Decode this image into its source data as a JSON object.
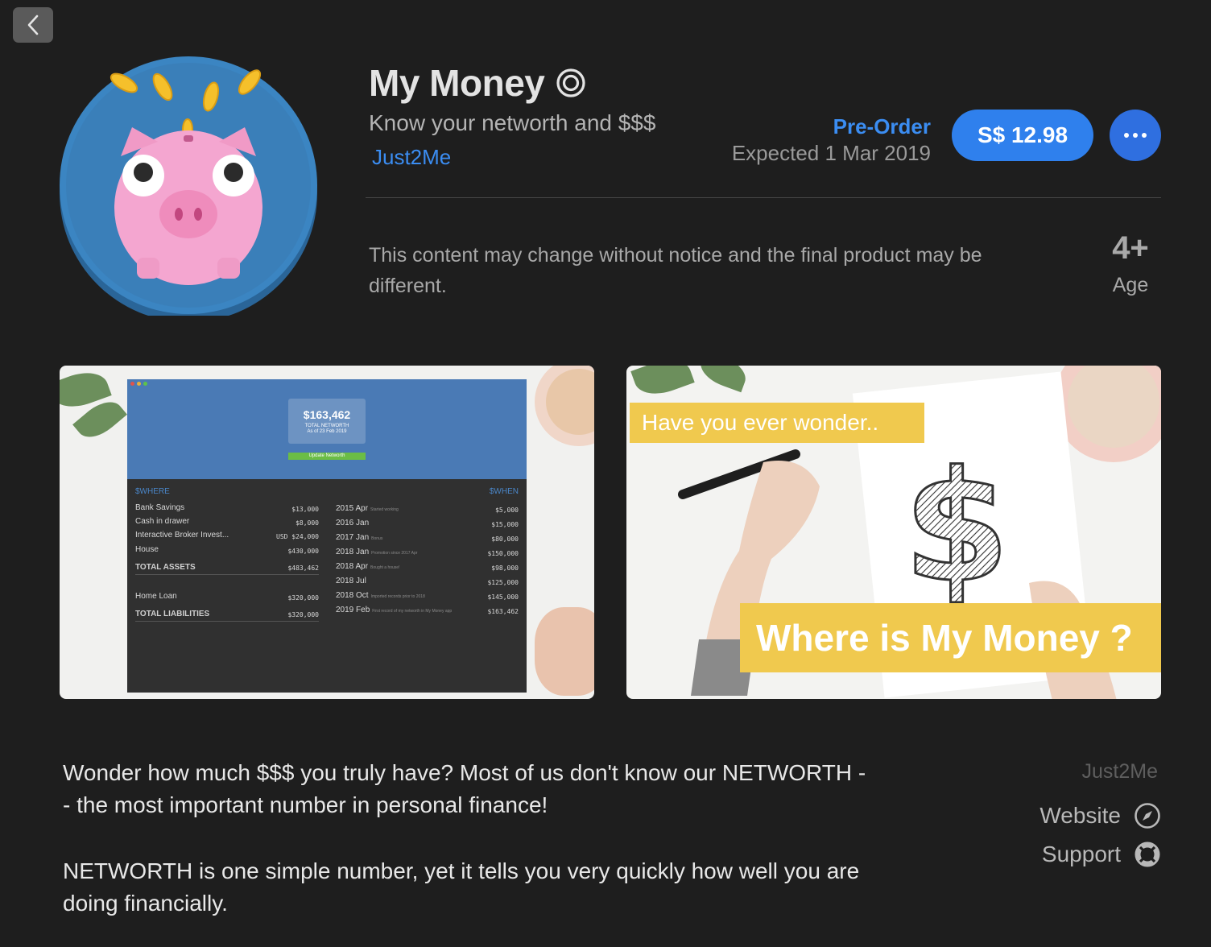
{
  "app": {
    "title": "My Money",
    "subtitle": "Know your networth and $$$",
    "developer": "Just2Me"
  },
  "purchase": {
    "status": "Pre-Order",
    "expected": "Expected 1 Mar 2019",
    "price": "S$ 12.98"
  },
  "notice": "This content may change without notice and the final product may be different.",
  "age": {
    "value": "4+",
    "label": "Age"
  },
  "screenshot1": {
    "networth_amount": "$163,462",
    "networth_label": "TOTAL NETWORTH",
    "networth_date": "As of 23 Feb 2019",
    "update_button": "Update Networth",
    "where_header": "$WHERE",
    "when_header": "$WHEN",
    "assets": [
      {
        "name": "Bank Savings",
        "value": "$13,000"
      },
      {
        "name": "Cash in drawer",
        "value": "$8,000"
      },
      {
        "name": "Interactive Broker Invest...",
        "value": "USD $24,000"
      },
      {
        "name": "House",
        "value": "$430,000"
      }
    ],
    "total_assets_label": "TOTAL ASSETS",
    "total_assets_value": "$483,462",
    "liabilities": [
      {
        "name": "Home Loan",
        "value": "$320,000"
      }
    ],
    "total_liabilities_label": "TOTAL LIABILITIES",
    "total_liabilities_value": "$320,000",
    "history": [
      {
        "date": "2015 Apr",
        "note": "Started working",
        "value": "$5,000"
      },
      {
        "date": "2016 Jan",
        "note": "",
        "value": "$15,000"
      },
      {
        "date": "2017 Jan",
        "note": "Bonus",
        "value": "$80,000"
      },
      {
        "date": "2018 Jan",
        "note": "Promotion since 2017 Apr",
        "value": "$150,000"
      },
      {
        "date": "2018 Apr",
        "note": "Bought a house!",
        "value": "$98,000"
      },
      {
        "date": "2018 Jul",
        "note": "",
        "value": "$125,000"
      },
      {
        "date": "2018 Oct",
        "note": "Imported records prior to 2018",
        "value": "$145,000"
      },
      {
        "date": "2019 Feb",
        "note": "First record of my networth in My Money app",
        "value": "$163,462"
      }
    ]
  },
  "screenshot2": {
    "banner_top": "Have you ever wonder..",
    "banner_bottom": "Where is My Money ?"
  },
  "description": {
    "p1": "Wonder how much $$$ you truly have? Most of us don't know our NETWORTH -- the most important number in personal finance!",
    "p2": "NETWORTH is one simple number, yet it tells you very quickly how well you are doing financially."
  },
  "sidebar": {
    "developer": "Just2Me",
    "website": "Website",
    "support": "Support"
  },
  "icons": {
    "back": "chevron-left-icon",
    "preorder": "preorder-circle-icon",
    "more": "ellipsis-icon",
    "website": "compass-icon",
    "support": "lifebuoy-icon"
  },
  "colors": {
    "accent": "#3b8df2",
    "price_button": "#2f80ed",
    "banner": "#f0c94e",
    "background": "#1e1e1e"
  }
}
